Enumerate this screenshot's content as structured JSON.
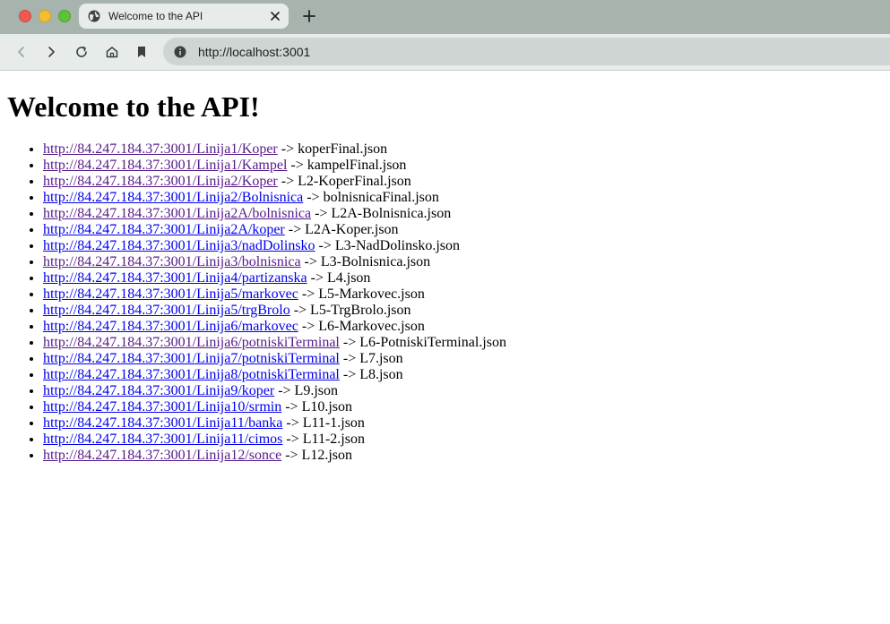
{
  "browser": {
    "tab_title": "Welcome to the API",
    "url": "http://localhost:3001",
    "colors": {
      "tabstrip": "#a7b4ae",
      "toolbar": "#e7ecea",
      "omnibox": "#cfd5d2"
    }
  },
  "page": {
    "heading": "Welcome to the API!",
    "routes": [
      {
        "url": "http://84.247.184.37:3001/Linija1/Koper",
        "file": "-> koperFinal.json",
        "visited": true
      },
      {
        "url": "http://84.247.184.37:3001/Linija1/Kampel",
        "file": "-> kampelFinal.json",
        "visited": true
      },
      {
        "url": "http://84.247.184.37:3001/Linija2/Koper",
        "file": "-> L2-KoperFinal.json",
        "visited": true
      },
      {
        "url": "http://84.247.184.37:3001/Linija2/Bolnisnica",
        "file": "-> bolnisnicaFinal.json",
        "visited": false
      },
      {
        "url": "http://84.247.184.37:3001/Linija2A/bolnisnica",
        "file": "-> L2A-Bolnisnica.json",
        "visited": true
      },
      {
        "url": "http://84.247.184.37:3001/Linija2A/koper",
        "file": "-> L2A-Koper.json",
        "visited": false
      },
      {
        "url": "http://84.247.184.37:3001/Linija3/nadDolinsko",
        "file": "-> L3-NadDolinsko.json",
        "visited": false
      },
      {
        "url": "http://84.247.184.37:3001/Linija3/bolnisnica",
        "file": "-> L3-Bolnisnica.json",
        "visited": true
      },
      {
        "url": "http://84.247.184.37:3001/Linija4/partizanska",
        "file": "-> L4.json",
        "visited": false
      },
      {
        "url": "http://84.247.184.37:3001/Linija5/markovec",
        "file": "-> L5-Markovec.json",
        "visited": false
      },
      {
        "url": "http://84.247.184.37:3001/Linija5/trgBrolo",
        "file": "-> L5-TrgBrolo.json",
        "visited": false
      },
      {
        "url": "http://84.247.184.37:3001/Linija6/markovec",
        "file": "-> L6-Markovec.json",
        "visited": false
      },
      {
        "url": "http://84.247.184.37:3001/Linija6/potniskiTerminal",
        "file": "-> L6-PotniskiTerminal.json",
        "visited": true
      },
      {
        "url": "http://84.247.184.37:3001/Linija7/potniskiTerminal",
        "file": "-> L7.json",
        "visited": false
      },
      {
        "url": "http://84.247.184.37:3001/Linija8/potniskiTerminal",
        "file": "-> L8.json",
        "visited": false
      },
      {
        "url": "http://84.247.184.37:3001/Linija9/koper",
        "file": "-> L9.json",
        "visited": false
      },
      {
        "url": "http://84.247.184.37:3001/Linija10/srmin",
        "file": "-> L10.json",
        "visited": false
      },
      {
        "url": "http://84.247.184.37:3001/Linija11/banka",
        "file": "-> L11-1.json",
        "visited": false
      },
      {
        "url": "http://84.247.184.37:3001/Linija11/cimos",
        "file": "-> L11-2.json",
        "visited": false
      },
      {
        "url": "http://84.247.184.37:3001/Linija12/sonce",
        "file": "-> L12.json",
        "visited": true
      }
    ]
  }
}
